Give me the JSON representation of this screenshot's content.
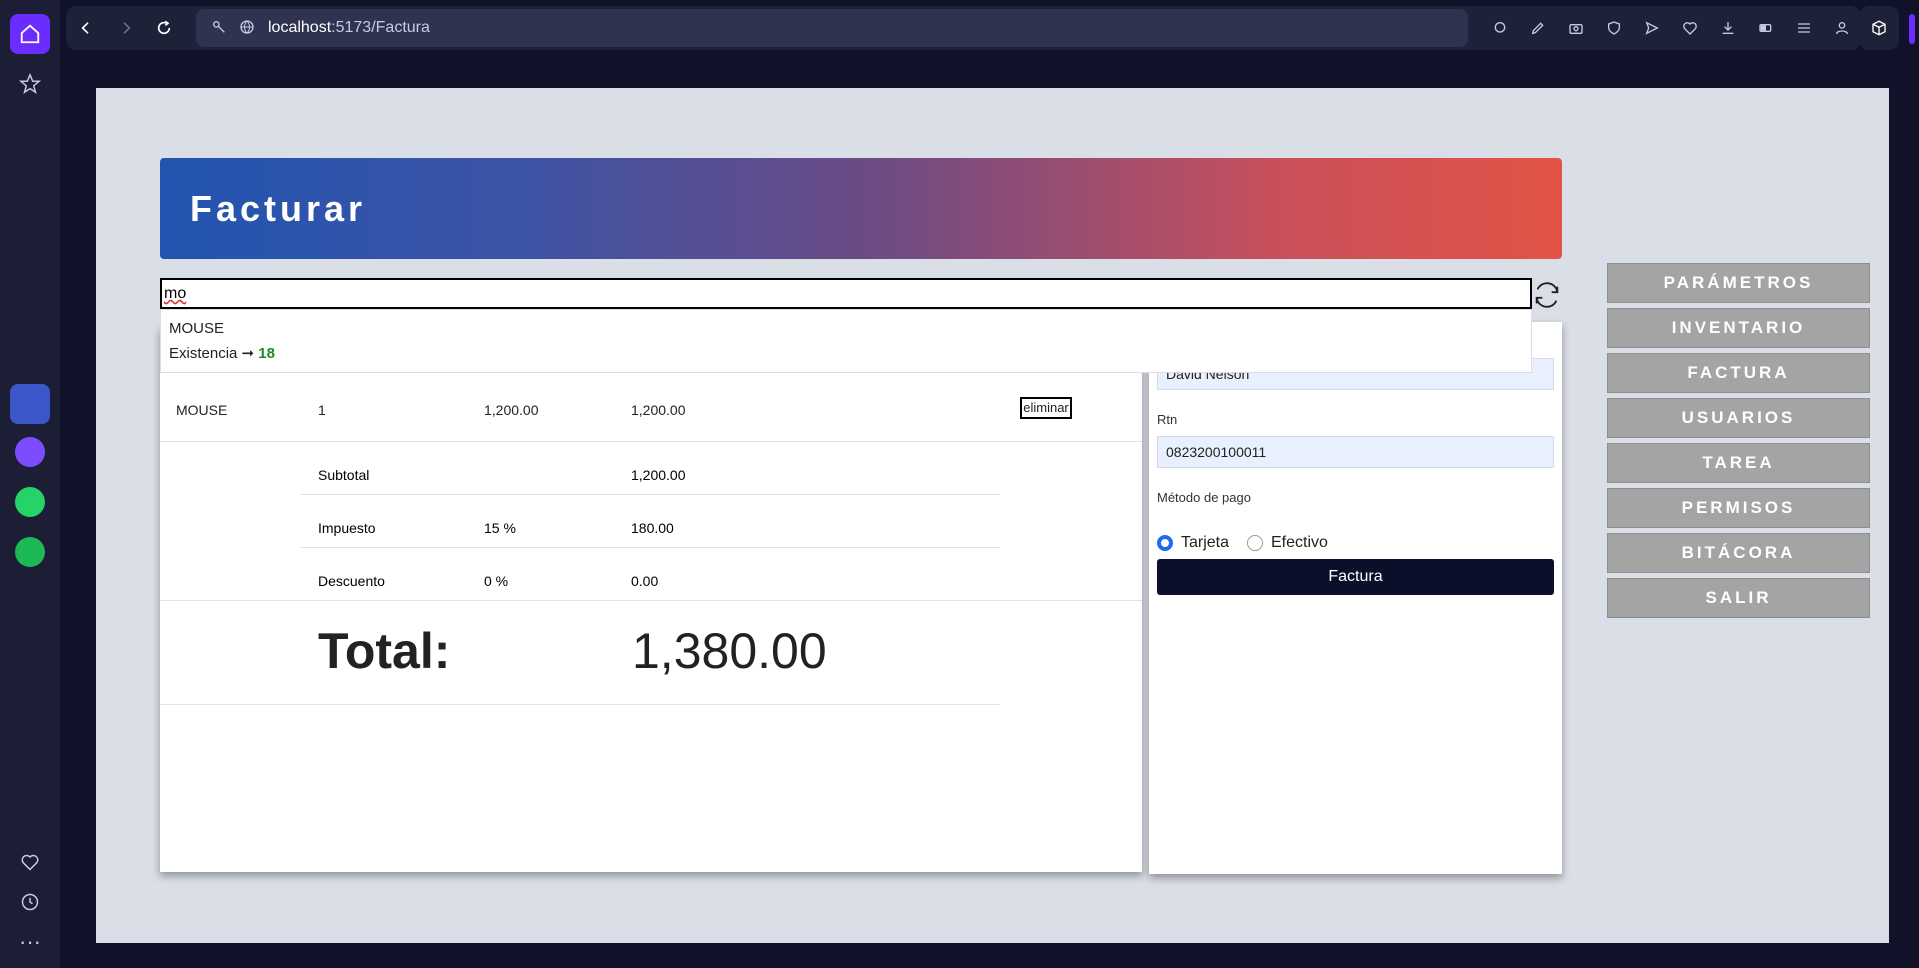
{
  "browser": {
    "url_host": "localhost",
    "url_path": ":5173/Factura"
  },
  "page": {
    "title": "Facturar",
    "search_value": "mo",
    "suggestion": {
      "name": "MOUSE",
      "stock_label": "Existencia ➞",
      "stock_value": "18"
    },
    "items": [
      {
        "product": "MOUSE",
        "qty": "1",
        "price": "1,200.00",
        "total": "1,200.00",
        "action": "eliminar"
      }
    ],
    "summary": [
      {
        "label": "Subtotal",
        "rate": "",
        "value": "1,200.00"
      },
      {
        "label": "Impuesto",
        "rate": "15 %",
        "value": "180.00"
      },
      {
        "label": "Descuento",
        "rate": "0 %",
        "value": "0.00"
      }
    ],
    "total_label": "Total:",
    "total_value": "1,380.00"
  },
  "form": {
    "customer_name": "David Nelson",
    "rtn_label": "Rtn",
    "rtn_value": "0823200100011",
    "payment_label": "Método de pago",
    "payment_options": [
      "Tarjeta",
      "Efectivo"
    ],
    "payment_selected": "Tarjeta",
    "submit_label": "Factura"
  },
  "menu": [
    "PARÁMETROS",
    "INVENTARIO",
    "FACTURA",
    "USUARIOS",
    "TAREA",
    "PERMISOS",
    "BITÁCORA",
    "SALIR"
  ]
}
